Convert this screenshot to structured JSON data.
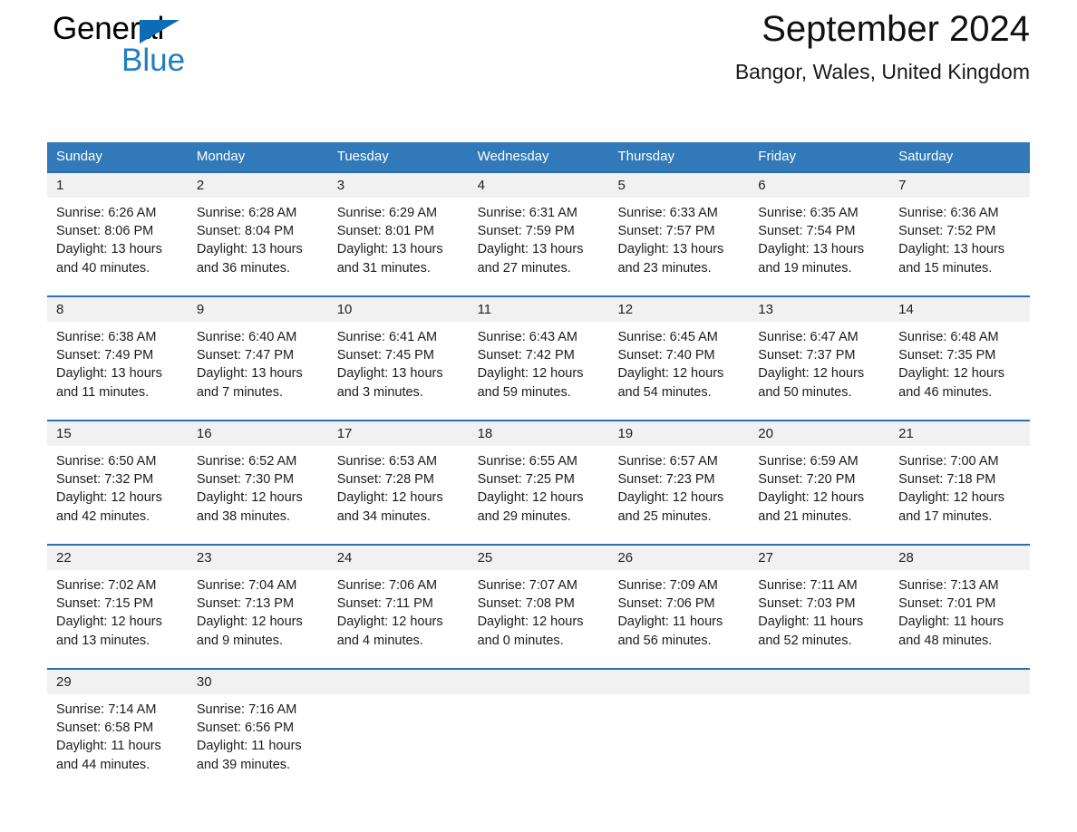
{
  "brand": {
    "name_part1": "General",
    "name_part2": "Blue",
    "logo_icon": "triangle-flag-icon",
    "accent_color": "#0d6cb6",
    "blue_text_color": "#1f7ec4"
  },
  "header": {
    "title": "September 2024",
    "subtitle": "Bangor, Wales, United Kingdom"
  },
  "theme": {
    "header_row_color": "#3179b8",
    "day_number_band_color": "#f1f1f1",
    "week_separator_color": "#2e6db0",
    "page_background": "#ffffff"
  },
  "calendar": {
    "weekday_headers": [
      "Sunday",
      "Monday",
      "Tuesday",
      "Wednesday",
      "Thursday",
      "Friday",
      "Saturday"
    ],
    "weeks": [
      {
        "days": [
          {
            "day": "1",
            "sunrise": "Sunrise: 6:26 AM",
            "sunset": "Sunset: 8:06 PM",
            "daylight_line1": "Daylight: 13 hours",
            "daylight_line2": "and 40 minutes."
          },
          {
            "day": "2",
            "sunrise": "Sunrise: 6:28 AM",
            "sunset": "Sunset: 8:04 PM",
            "daylight_line1": "Daylight: 13 hours",
            "daylight_line2": "and 36 minutes."
          },
          {
            "day": "3",
            "sunrise": "Sunrise: 6:29 AM",
            "sunset": "Sunset: 8:01 PM",
            "daylight_line1": "Daylight: 13 hours",
            "daylight_line2": "and 31 minutes."
          },
          {
            "day": "4",
            "sunrise": "Sunrise: 6:31 AM",
            "sunset": "Sunset: 7:59 PM",
            "daylight_line1": "Daylight: 13 hours",
            "daylight_line2": "and 27 minutes."
          },
          {
            "day": "5",
            "sunrise": "Sunrise: 6:33 AM",
            "sunset": "Sunset: 7:57 PM",
            "daylight_line1": "Daylight: 13 hours",
            "daylight_line2": "and 23 minutes."
          },
          {
            "day": "6",
            "sunrise": "Sunrise: 6:35 AM",
            "sunset": "Sunset: 7:54 PM",
            "daylight_line1": "Daylight: 13 hours",
            "daylight_line2": "and 19 minutes."
          },
          {
            "day": "7",
            "sunrise": "Sunrise: 6:36 AM",
            "sunset": "Sunset: 7:52 PM",
            "daylight_line1": "Daylight: 13 hours",
            "daylight_line2": "and 15 minutes."
          }
        ]
      },
      {
        "days": [
          {
            "day": "8",
            "sunrise": "Sunrise: 6:38 AM",
            "sunset": "Sunset: 7:49 PM",
            "daylight_line1": "Daylight: 13 hours",
            "daylight_line2": "and 11 minutes."
          },
          {
            "day": "9",
            "sunrise": "Sunrise: 6:40 AM",
            "sunset": "Sunset: 7:47 PM",
            "daylight_line1": "Daylight: 13 hours",
            "daylight_line2": "and 7 minutes."
          },
          {
            "day": "10",
            "sunrise": "Sunrise: 6:41 AM",
            "sunset": "Sunset: 7:45 PM",
            "daylight_line1": "Daylight: 13 hours",
            "daylight_line2": "and 3 minutes."
          },
          {
            "day": "11",
            "sunrise": "Sunrise: 6:43 AM",
            "sunset": "Sunset: 7:42 PM",
            "daylight_line1": "Daylight: 12 hours",
            "daylight_line2": "and 59 minutes."
          },
          {
            "day": "12",
            "sunrise": "Sunrise: 6:45 AM",
            "sunset": "Sunset: 7:40 PM",
            "daylight_line1": "Daylight: 12 hours",
            "daylight_line2": "and 54 minutes."
          },
          {
            "day": "13",
            "sunrise": "Sunrise: 6:47 AM",
            "sunset": "Sunset: 7:37 PM",
            "daylight_line1": "Daylight: 12 hours",
            "daylight_line2": "and 50 minutes."
          },
          {
            "day": "14",
            "sunrise": "Sunrise: 6:48 AM",
            "sunset": "Sunset: 7:35 PM",
            "daylight_line1": "Daylight: 12 hours",
            "daylight_line2": "and 46 minutes."
          }
        ]
      },
      {
        "days": [
          {
            "day": "15",
            "sunrise": "Sunrise: 6:50 AM",
            "sunset": "Sunset: 7:32 PM",
            "daylight_line1": "Daylight: 12 hours",
            "daylight_line2": "and 42 minutes."
          },
          {
            "day": "16",
            "sunrise": "Sunrise: 6:52 AM",
            "sunset": "Sunset: 7:30 PM",
            "daylight_line1": "Daylight: 12 hours",
            "daylight_line2": "and 38 minutes."
          },
          {
            "day": "17",
            "sunrise": "Sunrise: 6:53 AM",
            "sunset": "Sunset: 7:28 PM",
            "daylight_line1": "Daylight: 12 hours",
            "daylight_line2": "and 34 minutes."
          },
          {
            "day": "18",
            "sunrise": "Sunrise: 6:55 AM",
            "sunset": "Sunset: 7:25 PM",
            "daylight_line1": "Daylight: 12 hours",
            "daylight_line2": "and 29 minutes."
          },
          {
            "day": "19",
            "sunrise": "Sunrise: 6:57 AM",
            "sunset": "Sunset: 7:23 PM",
            "daylight_line1": "Daylight: 12 hours",
            "daylight_line2": "and 25 minutes."
          },
          {
            "day": "20",
            "sunrise": "Sunrise: 6:59 AM",
            "sunset": "Sunset: 7:20 PM",
            "daylight_line1": "Daylight: 12 hours",
            "daylight_line2": "and 21 minutes."
          },
          {
            "day": "21",
            "sunrise": "Sunrise: 7:00 AM",
            "sunset": "Sunset: 7:18 PM",
            "daylight_line1": "Daylight: 12 hours",
            "daylight_line2": "and 17 minutes."
          }
        ]
      },
      {
        "days": [
          {
            "day": "22",
            "sunrise": "Sunrise: 7:02 AM",
            "sunset": "Sunset: 7:15 PM",
            "daylight_line1": "Daylight: 12 hours",
            "daylight_line2": "and 13 minutes."
          },
          {
            "day": "23",
            "sunrise": "Sunrise: 7:04 AM",
            "sunset": "Sunset: 7:13 PM",
            "daylight_line1": "Daylight: 12 hours",
            "daylight_line2": "and 9 minutes."
          },
          {
            "day": "24",
            "sunrise": "Sunrise: 7:06 AM",
            "sunset": "Sunset: 7:11 PM",
            "daylight_line1": "Daylight: 12 hours",
            "daylight_line2": "and 4 minutes."
          },
          {
            "day": "25",
            "sunrise": "Sunrise: 7:07 AM",
            "sunset": "Sunset: 7:08 PM",
            "daylight_line1": "Daylight: 12 hours",
            "daylight_line2": "and 0 minutes."
          },
          {
            "day": "26",
            "sunrise": "Sunrise: 7:09 AM",
            "sunset": "Sunset: 7:06 PM",
            "daylight_line1": "Daylight: 11 hours",
            "daylight_line2": "and 56 minutes."
          },
          {
            "day": "27",
            "sunrise": "Sunrise: 7:11 AM",
            "sunset": "Sunset: 7:03 PM",
            "daylight_line1": "Daylight: 11 hours",
            "daylight_line2": "and 52 minutes."
          },
          {
            "day": "28",
            "sunrise": "Sunrise: 7:13 AM",
            "sunset": "Sunset: 7:01 PM",
            "daylight_line1": "Daylight: 11 hours",
            "daylight_line2": "and 48 minutes."
          }
        ]
      },
      {
        "days": [
          {
            "day": "29",
            "sunrise": "Sunrise: 7:14 AM",
            "sunset": "Sunset: 6:58 PM",
            "daylight_line1": "Daylight: 11 hours",
            "daylight_line2": "and 44 minutes."
          },
          {
            "day": "30",
            "sunrise": "Sunrise: 7:16 AM",
            "sunset": "Sunset: 6:56 PM",
            "daylight_line1": "Daylight: 11 hours",
            "daylight_line2": "and 39 minutes."
          },
          {
            "day": "",
            "sunrise": "",
            "sunset": "",
            "daylight_line1": "",
            "daylight_line2": ""
          },
          {
            "day": "",
            "sunrise": "",
            "sunset": "",
            "daylight_line1": "",
            "daylight_line2": ""
          },
          {
            "day": "",
            "sunrise": "",
            "sunset": "",
            "daylight_line1": "",
            "daylight_line2": ""
          },
          {
            "day": "",
            "sunrise": "",
            "sunset": "",
            "daylight_line1": "",
            "daylight_line2": ""
          },
          {
            "day": "",
            "sunrise": "",
            "sunset": "",
            "daylight_line1": "",
            "daylight_line2": ""
          }
        ]
      }
    ]
  }
}
